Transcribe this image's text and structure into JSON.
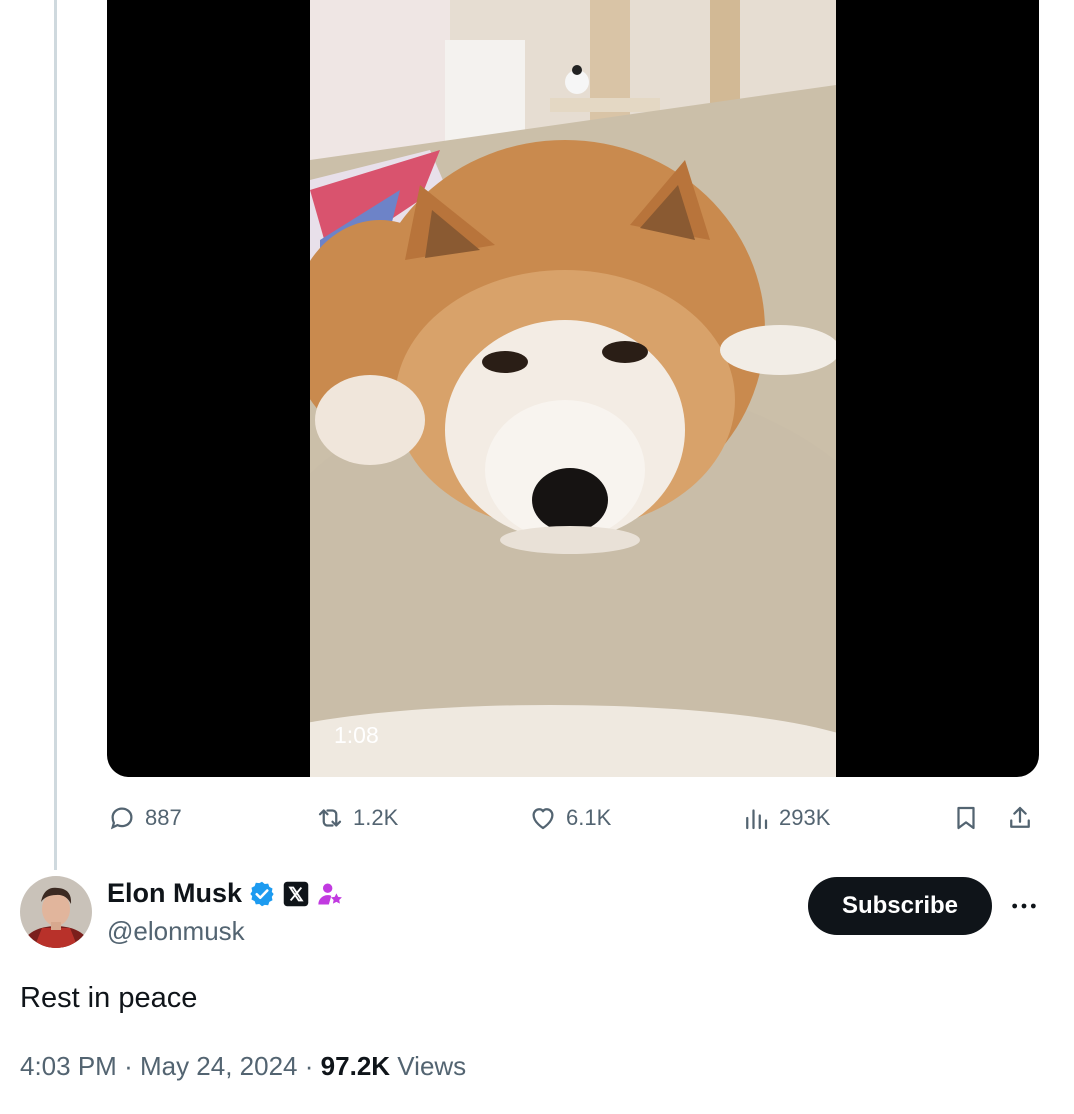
{
  "media": {
    "duration": "1:08"
  },
  "actions": {
    "replies": "887",
    "retweets": "1.2K",
    "likes": "6.1K",
    "views": "293K"
  },
  "author": {
    "name": "Elon Musk",
    "handle": "@elonmusk",
    "subscribe_label": "Subscribe"
  },
  "tweet": {
    "text": "Rest in peace",
    "time": "4:03 PM",
    "date": "May 24, 2024",
    "views_count": "97.2K",
    "views_label": "Views",
    "separator": "·"
  },
  "colors": {
    "text_primary": "#0f1419",
    "text_secondary": "#536471",
    "verified_blue": "#1d9bf0",
    "thread_line": "#cfd9de"
  }
}
